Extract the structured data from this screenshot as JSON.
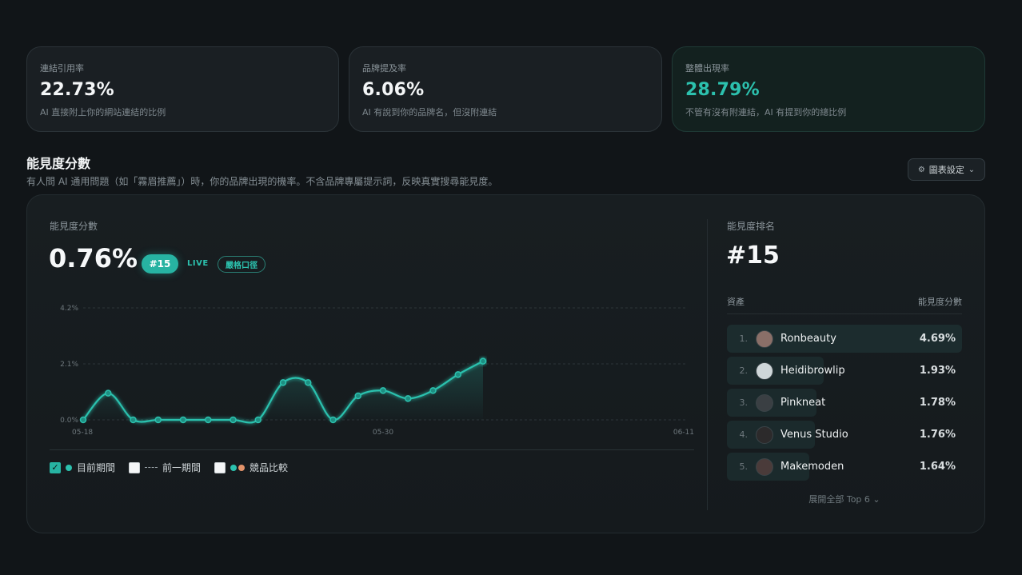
{
  "metrics": [
    {
      "label": "連結引用率",
      "value": "22.73%",
      "desc": "AI 直接附上你的網站連結的比例"
    },
    {
      "label": "品牌提及率",
      "value": "6.06%",
      "desc": "AI 有說到你的品牌名，但沒附連結"
    },
    {
      "label": "整體出現率",
      "value": "28.79%",
      "desc": "不管有沒有附連結，AI 有提到你的總比例"
    }
  ],
  "section": {
    "title": "能見度分數",
    "subtitle": "有人問 AI 通用問題（如「霧眉推薦」）時，你的品牌出現的機率。不含品牌專屬提示詞，反映真實搜尋能見度。",
    "settings_label": "圖表設定",
    "settings_icon": "sliders-icon",
    "settings_chevron": "⌄"
  },
  "score": {
    "label": "能見度分數",
    "value": "0.76%",
    "rank_badge": "#15",
    "live": "LIVE",
    "strict": "嚴格口徑"
  },
  "chart_data": {
    "type": "line",
    "x": [
      "05-18",
      "05-19",
      "05-20",
      "05-21",
      "05-22",
      "05-23",
      "05-24",
      "05-25",
      "05-26",
      "05-27",
      "05-28",
      "05-29",
      "05-30",
      "05-31",
      "06-01",
      "06-02",
      "06-03",
      "06-04",
      "06-05",
      "06-06",
      "06-07",
      "06-08",
      "06-09",
      "06-10",
      "06-11"
    ],
    "series": [
      {
        "values": [
          0.0,
          1.0,
          0.0,
          0.0,
          0.0,
          0.0,
          0.0,
          0.0,
          1.4,
          1.4,
          0.0,
          0.9,
          1.1,
          0.8,
          1.1,
          1.7,
          2.2
        ]
      }
    ],
    "point_dates": [
      "05-18",
      "05-19",
      "05-20",
      "05-21",
      "05-22",
      "05-23",
      "05-24",
      "05-25",
      "05-26",
      "05-27",
      "05-28",
      "05-29",
      "05-30",
      "05-31",
      "06-01",
      "06-02",
      "06-03"
    ],
    "xticks": [
      "05-18",
      "05-30",
      "06-11"
    ],
    "yticks": [
      "4.2%",
      "2.1%",
      "0.0%"
    ],
    "ylim": [
      0,
      4.2
    ],
    "grid": true,
    "line_color": "#2cc1ae"
  },
  "legend": [
    {
      "label": "目前期間",
      "checked": true
    },
    {
      "label": "前一期間",
      "checked": false
    },
    {
      "label": "競品比較",
      "checked": false
    }
  ],
  "ranking": {
    "label": "能見度排名",
    "value": "#15",
    "col_asset": "資產",
    "col_score": "能見度分數",
    "rows": [
      {
        "rank": "1.",
        "name": "Ronbeauty",
        "score": "4.69%",
        "share": 1.0
      },
      {
        "rank": "2.",
        "name": "Heidibrowlip",
        "score": "1.93%",
        "share": 0.41
      },
      {
        "rank": "3.",
        "name": "Pinkneat",
        "score": "1.78%",
        "share": 0.38
      },
      {
        "rank": "4.",
        "name": "Venus Studio",
        "score": "1.76%",
        "share": 0.375
      },
      {
        "rank": "5.",
        "name": "Makemoden",
        "score": "1.64%",
        "share": 0.35
      }
    ],
    "expand_label": "展開全部 Top 6 ⌄"
  }
}
